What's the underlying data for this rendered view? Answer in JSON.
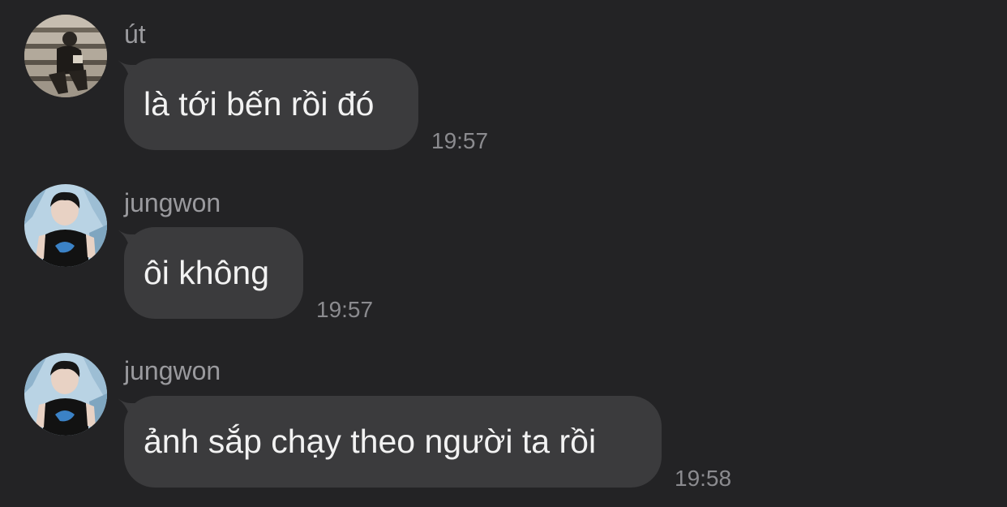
{
  "messages": [
    {
      "sender": "út",
      "text": "là tới bến rồi đó",
      "time": "19:57"
    },
    {
      "sender": "jungwon",
      "text": "ôi không",
      "time": "19:57"
    },
    {
      "sender": "jungwon",
      "text": "ảnh sắp chạy theo người ta rồi",
      "time": "19:58"
    }
  ],
  "colors": {
    "background": "#232325",
    "bubble": "#3b3b3d",
    "bubble_text": "#f2f2f2",
    "sender": "#9a9a9e",
    "time": "#8b8b8f"
  },
  "icons": {
    "avatar_ut": "person-on-stairs-photo-avatar",
    "avatar_jungwon": "person-in-black-tshirt-photo-avatar"
  }
}
